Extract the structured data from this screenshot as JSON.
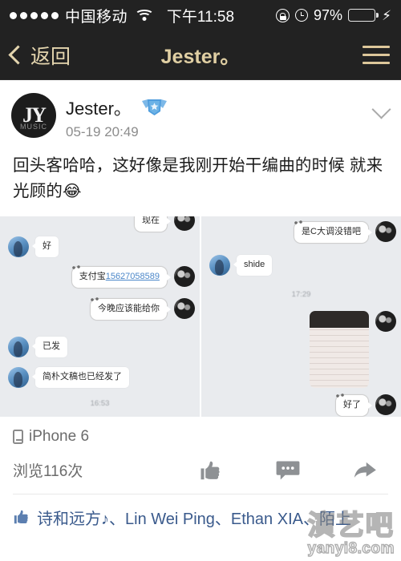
{
  "status_bar": {
    "signal_dots": 5,
    "carrier": "中国移动",
    "wifi_icon": "wifi-icon",
    "time": "下午11:58",
    "rotation_lock_icon": "rotation-lock-icon",
    "alarm_icon": "alarm-clock-icon",
    "battery_percent": "97%",
    "battery_level": 97,
    "battery_color": "#4cd964",
    "charging_icon": "⚡"
  },
  "nav_bar": {
    "back_label": "返回",
    "back_icon": "chevron-left-icon",
    "title": "Jester。",
    "menu_icon": "hamburger-menu-icon",
    "background_color": "#222222",
    "accent_color": "#e0cfa3"
  },
  "post": {
    "avatar_initials": "JY",
    "avatar_sub": "MUSIC",
    "author": "Jester。",
    "badge_icon": "verified-wings-badge-icon",
    "timestamp": "05-19 20:49",
    "collapse_icon": "chevron-down-icon",
    "body_text": "回头客哈哈，这好像是我刚开始干编曲的时候  就来光顾的",
    "body_emoji": "😂"
  },
  "images": [
    {
      "name": "chat-screenshot-left",
      "messages": [
        {
          "side": "right",
          "text": "现在",
          "cut_off": true
        },
        {
          "side": "left",
          "text": "好"
        },
        {
          "side": "right",
          "text": "支付宝",
          "link": "15627058589"
        },
        {
          "side": "right",
          "text": "今晚应该能给你"
        },
        {
          "side": "left",
          "text": "已发"
        },
        {
          "side": "left",
          "text": "简朴文稿也已经发了"
        }
      ],
      "time_separator": "16:53"
    },
    {
      "name": "chat-screenshot-right",
      "messages": [
        {
          "side": "right",
          "text": "是C大调没错吧"
        },
        {
          "side": "left",
          "text": "shide"
        },
        {
          "side": "right",
          "text": "photo",
          "is_photo": true
        },
        {
          "side": "right",
          "text": "好了"
        }
      ],
      "time_separator": "17:29"
    }
  ],
  "meta": {
    "device_icon": "mobile-phone-icon",
    "device": "iPhone 6",
    "views": "浏览116次",
    "like_icon": "thumbs-up-icon",
    "comment_icon": "comment-bubble-icon",
    "share_icon": "share-arrow-icon"
  },
  "likes": {
    "icon": "thumbs-up-small-icon",
    "names": "诗和远方♪、Lin Wei Ping、Ethan  XIA、陌上"
  },
  "watermark": {
    "cn": "演艺吧",
    "en": "yanyi8.com"
  }
}
